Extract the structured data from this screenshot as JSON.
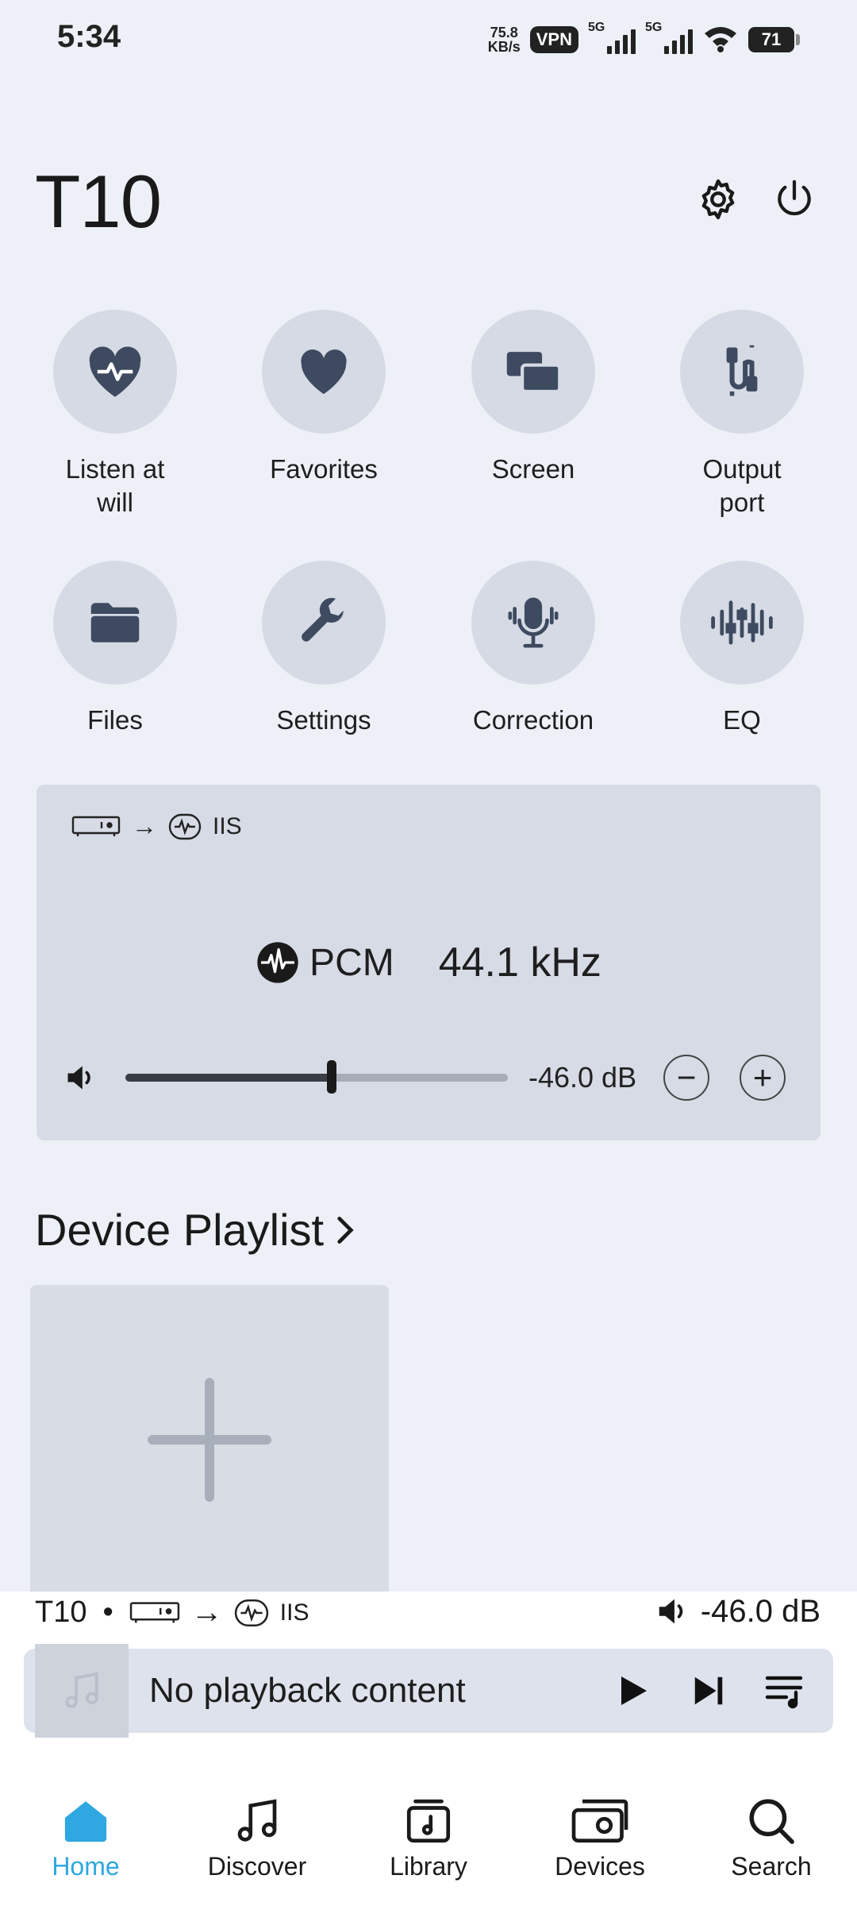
{
  "status_bar": {
    "time": "5:34",
    "net_speed_value": "75.8",
    "net_speed_unit": "KB/s",
    "vpn": "VPN",
    "sim1": "5G",
    "sim2": "5G",
    "battery": "71"
  },
  "header": {
    "device_name": "T10",
    "settings_icon": "gear-icon",
    "power_icon": "power-icon"
  },
  "quick_actions": [
    {
      "label": "Listen at\nwill",
      "icon": "heart-pulse-icon"
    },
    {
      "label": "Favorites",
      "icon": "heart-icon"
    },
    {
      "label": "Screen",
      "icon": "screen-icon"
    },
    {
      "label": "Output\nport",
      "icon": "cable-icon"
    },
    {
      "label": "Files",
      "icon": "folder-icon"
    },
    {
      "label": "Settings",
      "icon": "wrench-icon"
    },
    {
      "label": "Correction",
      "icon": "microphone-icon"
    },
    {
      "label": "EQ",
      "icon": "equalizer-icon"
    }
  ],
  "audio_card": {
    "output_path": "IIS",
    "format": "PCM",
    "sample_rate": "44.1 kHz",
    "volume_db": "-46.0 dB",
    "volume_level": 0.54
  },
  "playlist": {
    "title": "Device Playlist"
  },
  "now_playing": {
    "device": "T10",
    "separator": "•",
    "output_path": "IIS",
    "volume_db": "-46.0 dB",
    "content": "No playback content"
  },
  "nav": [
    {
      "label": "Home",
      "icon": "home-icon",
      "active": true
    },
    {
      "label": "Discover",
      "icon": "music-note-icon",
      "active": false
    },
    {
      "label": "Library",
      "icon": "library-icon",
      "active": false
    },
    {
      "label": "Devices",
      "icon": "devices-icon",
      "active": false
    },
    {
      "label": "Search",
      "icon": "search-icon",
      "active": false
    }
  ],
  "colors": {
    "accent": "#2FA7E0",
    "background": "#EDF0F7",
    "card": "#D6DBE6"
  }
}
